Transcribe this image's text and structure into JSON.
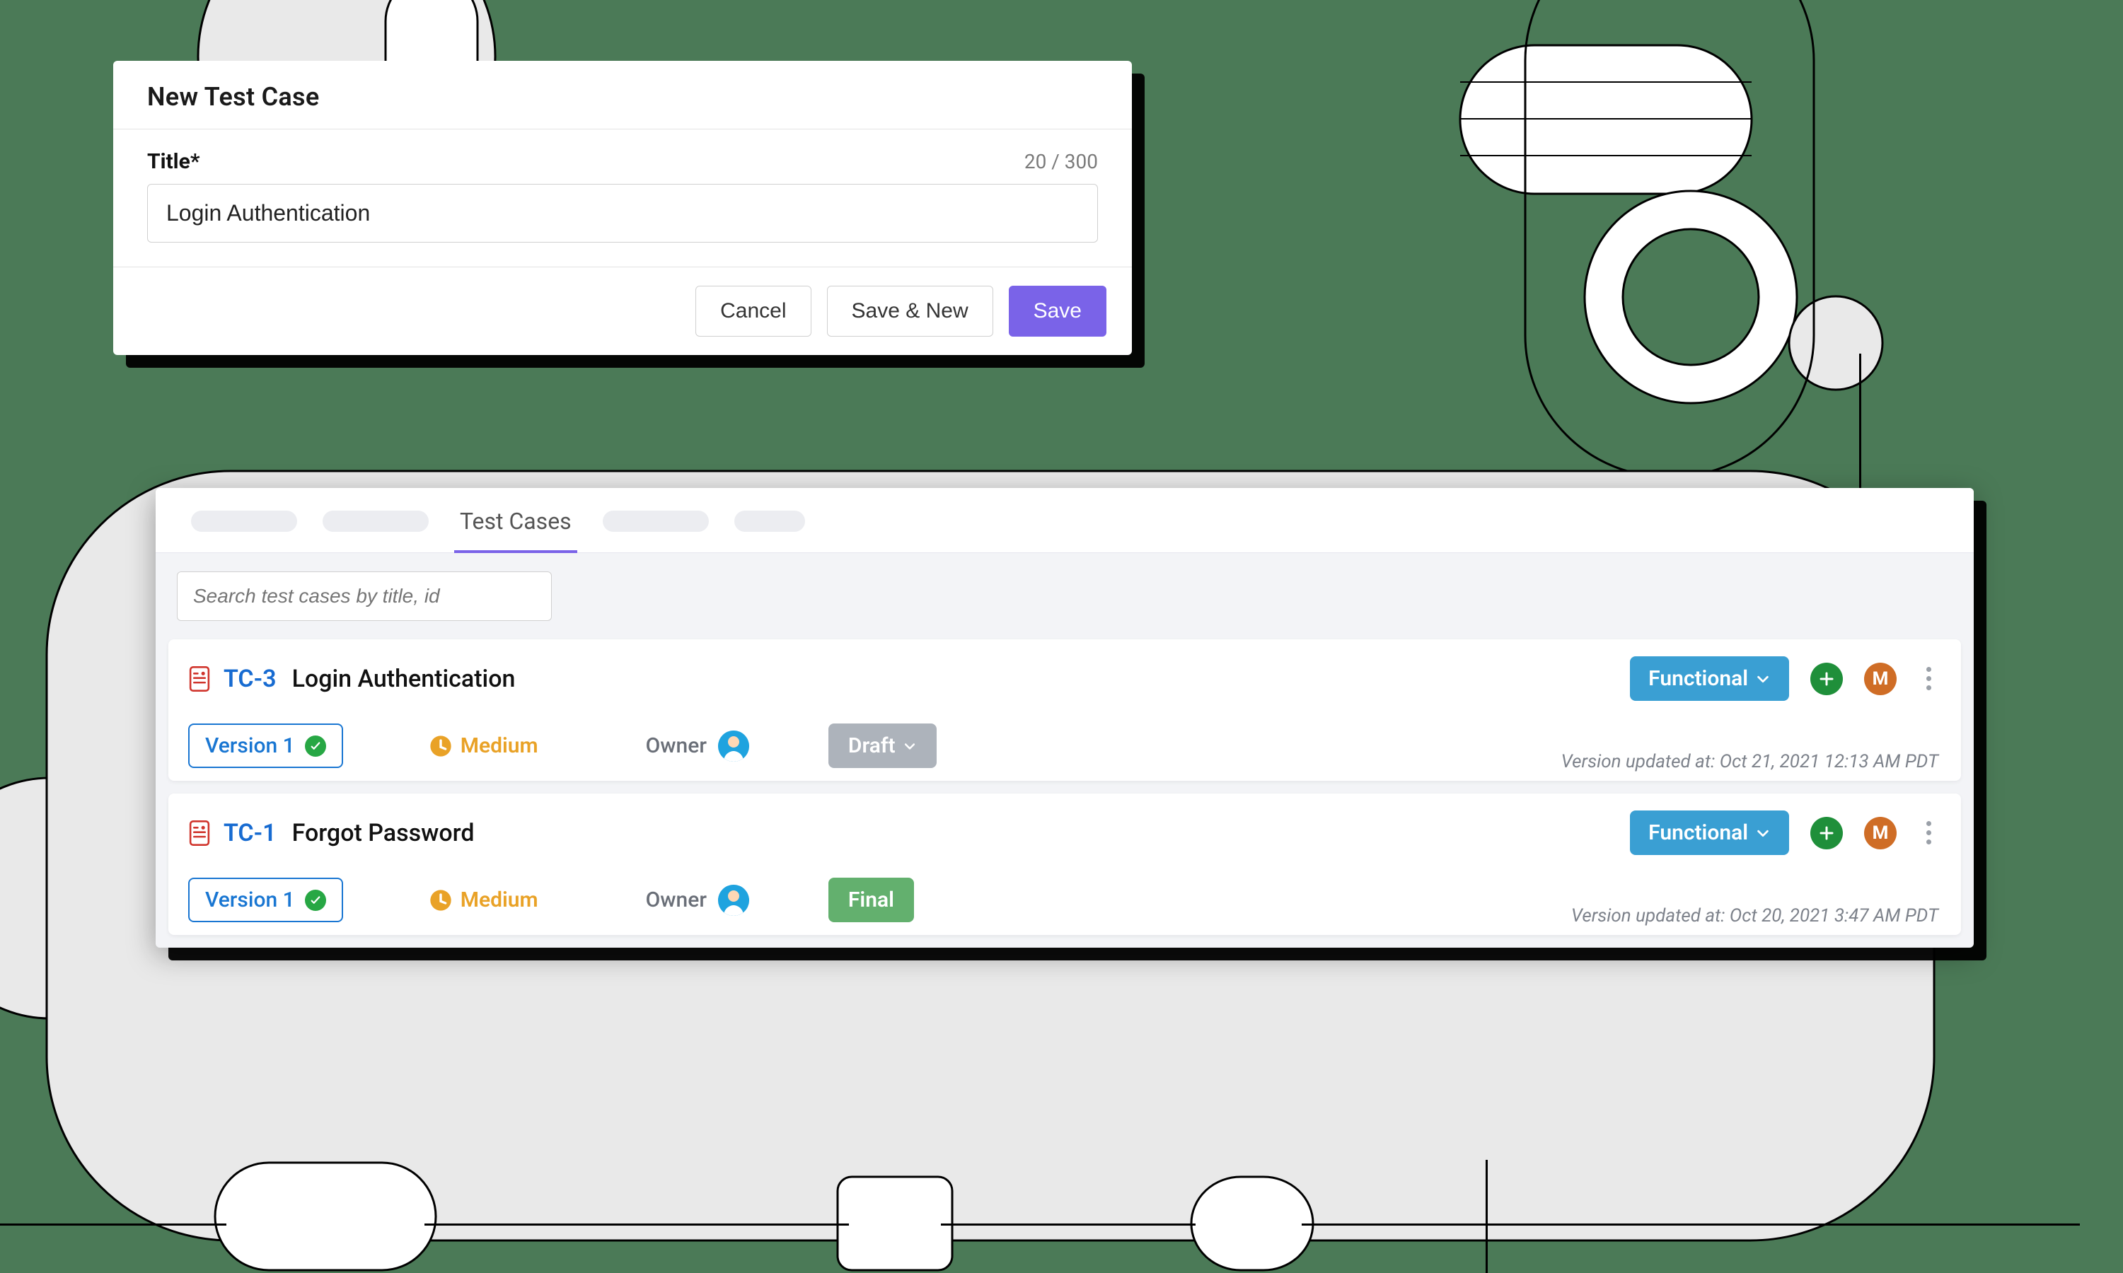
{
  "colors": {
    "accent": "#7a63e8",
    "background": "#4b7a57",
    "link": "#176bd1",
    "tag": "#3a9fd3",
    "success": "#27a744",
    "warning": "#e9a227",
    "draft": "#adb3bb",
    "final": "#63b06e"
  },
  "modal": {
    "title": "New Test Case",
    "field_label": "Title",
    "required_mark": "*",
    "counter": "20 / 300",
    "input_value": "Login Authentication",
    "buttons": {
      "cancel": "Cancel",
      "save_new": "Save & New",
      "save": "Save"
    }
  },
  "panel": {
    "active_tab": "Test Cases",
    "search_placeholder": "Search test cases by title, id",
    "owner_label": "Owner",
    "updated_prefix": "Version updated at:",
    "add_icon": "plus-icon",
    "m_badge_letter": "M",
    "rows": [
      {
        "id": "TC-3",
        "title": "Login Authentication",
        "tag": "Functional",
        "version": "Version 1",
        "priority": "Medium",
        "status": "Draft",
        "status_kind": "draft",
        "updated": "Oct 21, 2021 12:13 AM PDT"
      },
      {
        "id": "TC-1",
        "title": "Forgot Password",
        "tag": "Functional",
        "version": "Version 1",
        "priority": "Medium",
        "status": "Final",
        "status_kind": "final",
        "updated": "Oct 20, 2021 3:47 AM PDT"
      }
    ]
  }
}
